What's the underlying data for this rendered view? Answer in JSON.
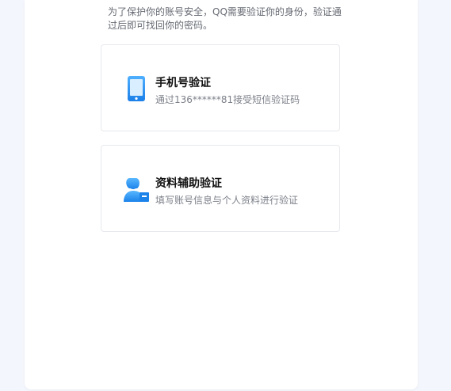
{
  "description": "为了保护你的账号安全，QQ需要验证你的身份，验证通过后即可找回你的密码。",
  "options": [
    {
      "title": "手机号验证",
      "subtitle": "通过136******81接受短信验证码",
      "icon": "phone-icon"
    },
    {
      "title": "资料辅助验证",
      "subtitle": "填写账号信息与个人资料进行验证",
      "icon": "user-id-icon"
    }
  ],
  "colors": {
    "accent": "#1b8ff5",
    "accent_light": "#6ec0ff",
    "background": "#f3f6fc",
    "card_border": "#e7e9ee"
  }
}
